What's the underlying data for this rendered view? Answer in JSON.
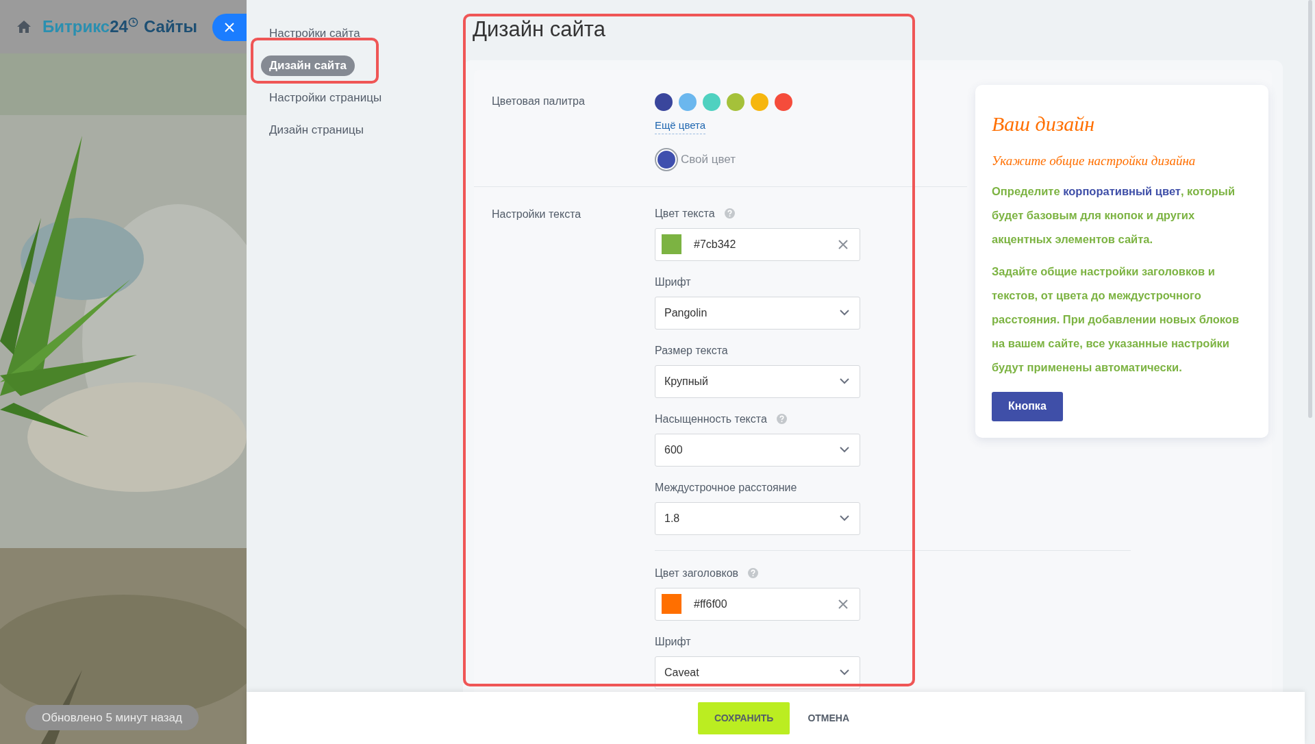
{
  "header": {
    "logo_main": "Битрикс",
    "logo_number": "24",
    "logo_suffix": "Сайты"
  },
  "status": "Обновлено 5 минут назад",
  "menu": [
    {
      "label": "Настройки сайта",
      "selected": false
    },
    {
      "label": "Дизайн сайта",
      "selected": true
    },
    {
      "label": "Настройки страницы",
      "selected": false
    },
    {
      "label": "Дизайн страницы",
      "selected": false
    }
  ],
  "page_title": "Дизайн сайта",
  "palette": {
    "label": "Цветовая палитра",
    "swatches": [
      {
        "color": "#3a469c",
        "selected": false
      },
      {
        "color": "#6bb7ee",
        "selected": false
      },
      {
        "color": "#4fd1c0",
        "selected": false
      },
      {
        "color": "#a5c13a",
        "selected": false
      },
      {
        "color": "#f6b60e",
        "selected": false
      },
      {
        "color": "#f54c3b",
        "selected": false
      }
    ],
    "more_link": "Ещё цвета",
    "custom": {
      "label": "Свой цвет",
      "color": "#3f4fae",
      "selected": true
    }
  },
  "text_settings": {
    "label": "Настройки текста",
    "fields": [
      {
        "kind": "color",
        "label": "Цвет текста",
        "help": true,
        "value": "#7cb342",
        "color": "#7cb342"
      },
      {
        "kind": "select",
        "label": "Шрифт",
        "help": false,
        "value": "Pangolin"
      },
      {
        "kind": "select",
        "label": "Размер текста",
        "help": false,
        "value": "Крупный"
      },
      {
        "kind": "select",
        "label": "Насыщенность текста",
        "help": true,
        "value": "600"
      },
      {
        "kind": "select",
        "label": "Междустрочное расстояние",
        "help": false,
        "value": "1.8"
      },
      {
        "kind": "divider"
      },
      {
        "kind": "color",
        "label": "Цвет заголовков",
        "help": true,
        "value": "#ff6f00",
        "color": "#ff6f00"
      },
      {
        "kind": "select",
        "label": "Шрифт",
        "help": false,
        "value": "Caveat"
      }
    ]
  },
  "preview": {
    "title": "Ваш дизайн",
    "subtitle": "Укажите общие настройки дизайна",
    "paragraphs": [
      "Определите **корпоративный цвет**, который будет базовым для кнопок и других акцентных элементов сайта.",
      "Задайте общие настройки заголовков и текстов, от цвета до междустрочного расстояния. При добавлении новых блоков на вашем сайте, все указанные настройки будут применены автоматически."
    ],
    "button": "Кнопка"
  },
  "footer": {
    "save": "СОХРАНИТЬ",
    "cancel": "ОТМЕНА"
  }
}
